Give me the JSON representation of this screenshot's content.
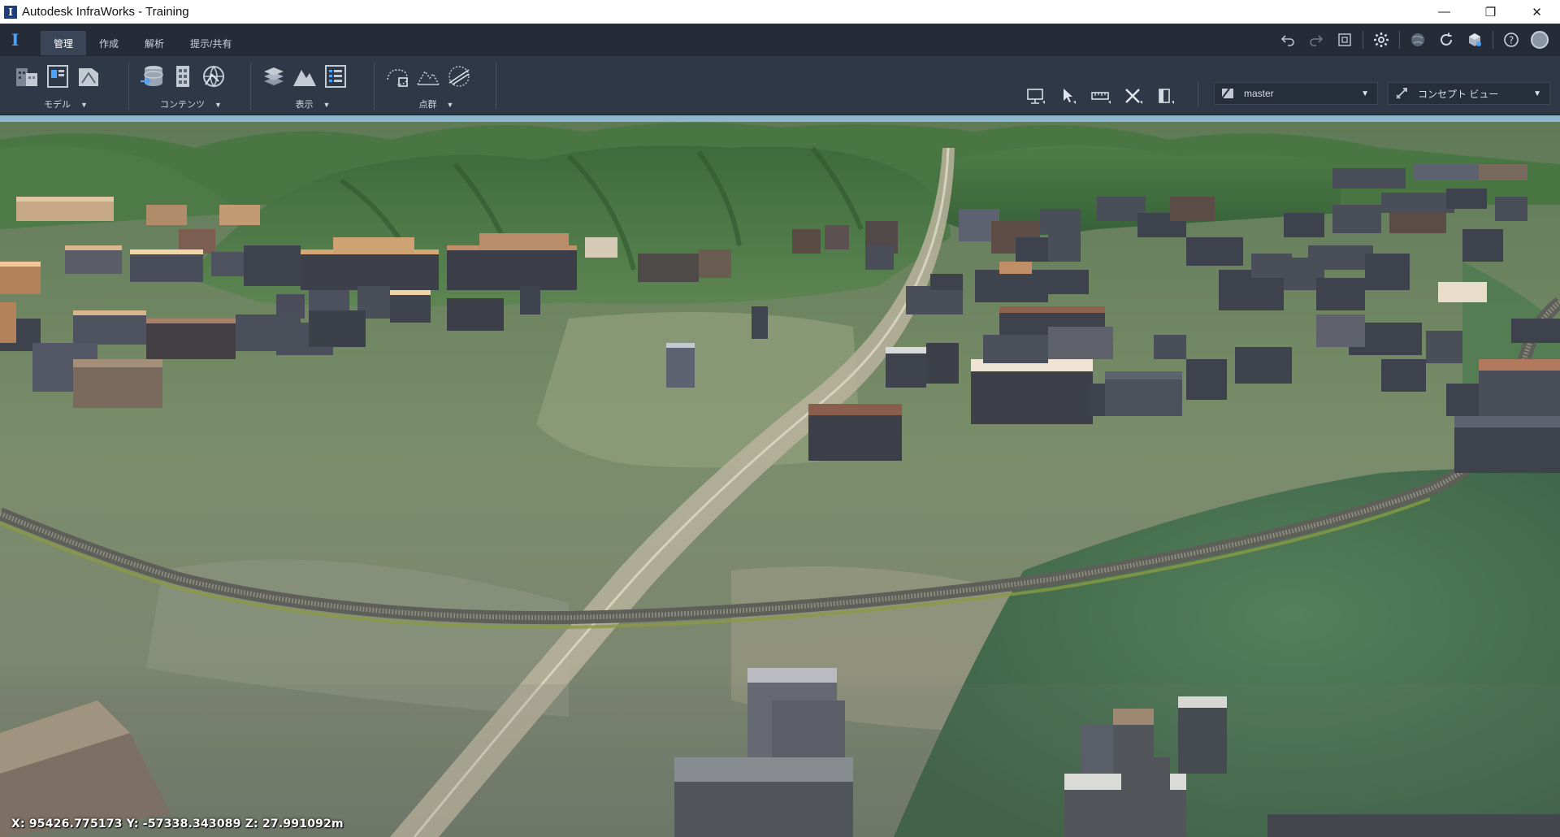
{
  "window": {
    "title": "Autodesk InfraWorks - Training",
    "controls": {
      "minimize": "—",
      "restore": "❐",
      "close": "✕"
    }
  },
  "ribbon_tabs": [
    {
      "label": "管理",
      "active": true
    },
    {
      "label": "作成",
      "active": false
    },
    {
      "label": "解析",
      "active": false
    },
    {
      "label": "提示/共有",
      "active": false
    }
  ],
  "ribbon_groups": {
    "model": {
      "label": "モデル"
    },
    "content": {
      "label": "コンテンツ"
    },
    "display": {
      "label": "表示"
    },
    "pointcloud": {
      "label": "点群"
    }
  },
  "top_icons": [
    "undo-icon",
    "redo-icon",
    "fit-view-icon",
    "settings-icon",
    "globe-icon",
    "sync-icon",
    "cube-icon",
    "help-icon",
    "user-avatar"
  ],
  "view_tools": [
    "presentation-icon",
    "select-icon",
    "measure-icon",
    "tools-icon",
    "clip-icon"
  ],
  "proposal_dropdown": {
    "value": "master"
  },
  "style_dropdown": {
    "value": "コンセプト ビュー"
  },
  "status": {
    "coordinates": "X: 95426.775173 Y: -57338.343089 Z: 27.991092m"
  },
  "colors": {
    "accent": "#4aa3ff",
    "ribbon_bg": "#2f3846",
    "tab_bg": "#252c38"
  }
}
